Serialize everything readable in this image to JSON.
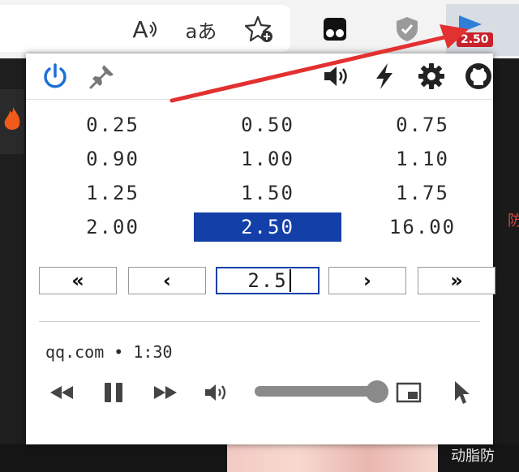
{
  "toolbar": {
    "icons": [
      "read-aloud-icon",
      "translate-icon",
      "add-favorite-icon",
      "tampermonkey-icon",
      "shield-check-icon",
      "video-speed-controller-icon"
    ],
    "read_aloud_label": "A",
    "translate_label": "aあ",
    "badge": "2.50"
  },
  "popup": {
    "header_icons": [
      "power-icon",
      "pin-icon",
      "audio-icon",
      "shortcut-icon",
      "settings-icon",
      "github-icon"
    ],
    "speeds": [
      "0.25",
      "0.50",
      "0.75",
      "0.90",
      "1.00",
      "1.10",
      "1.25",
      "1.50",
      "1.75",
      "2.00",
      "2.50",
      "16.00"
    ],
    "selected_speed": "2.50",
    "nav": {
      "slower_fast": "«",
      "slower": "‹",
      "faster": "›",
      "faster_fast": "»"
    },
    "input_value": "2.5",
    "site_info": "qq.com • 1:30",
    "volume_level": 1.0
  },
  "background": {
    "right_text": "动脂防",
    "side_text": "防"
  },
  "colors": {
    "accent": "#123fa8",
    "badge_bg": "#c8232c",
    "arrow": "#e33030",
    "power": "#1d6fd6"
  }
}
